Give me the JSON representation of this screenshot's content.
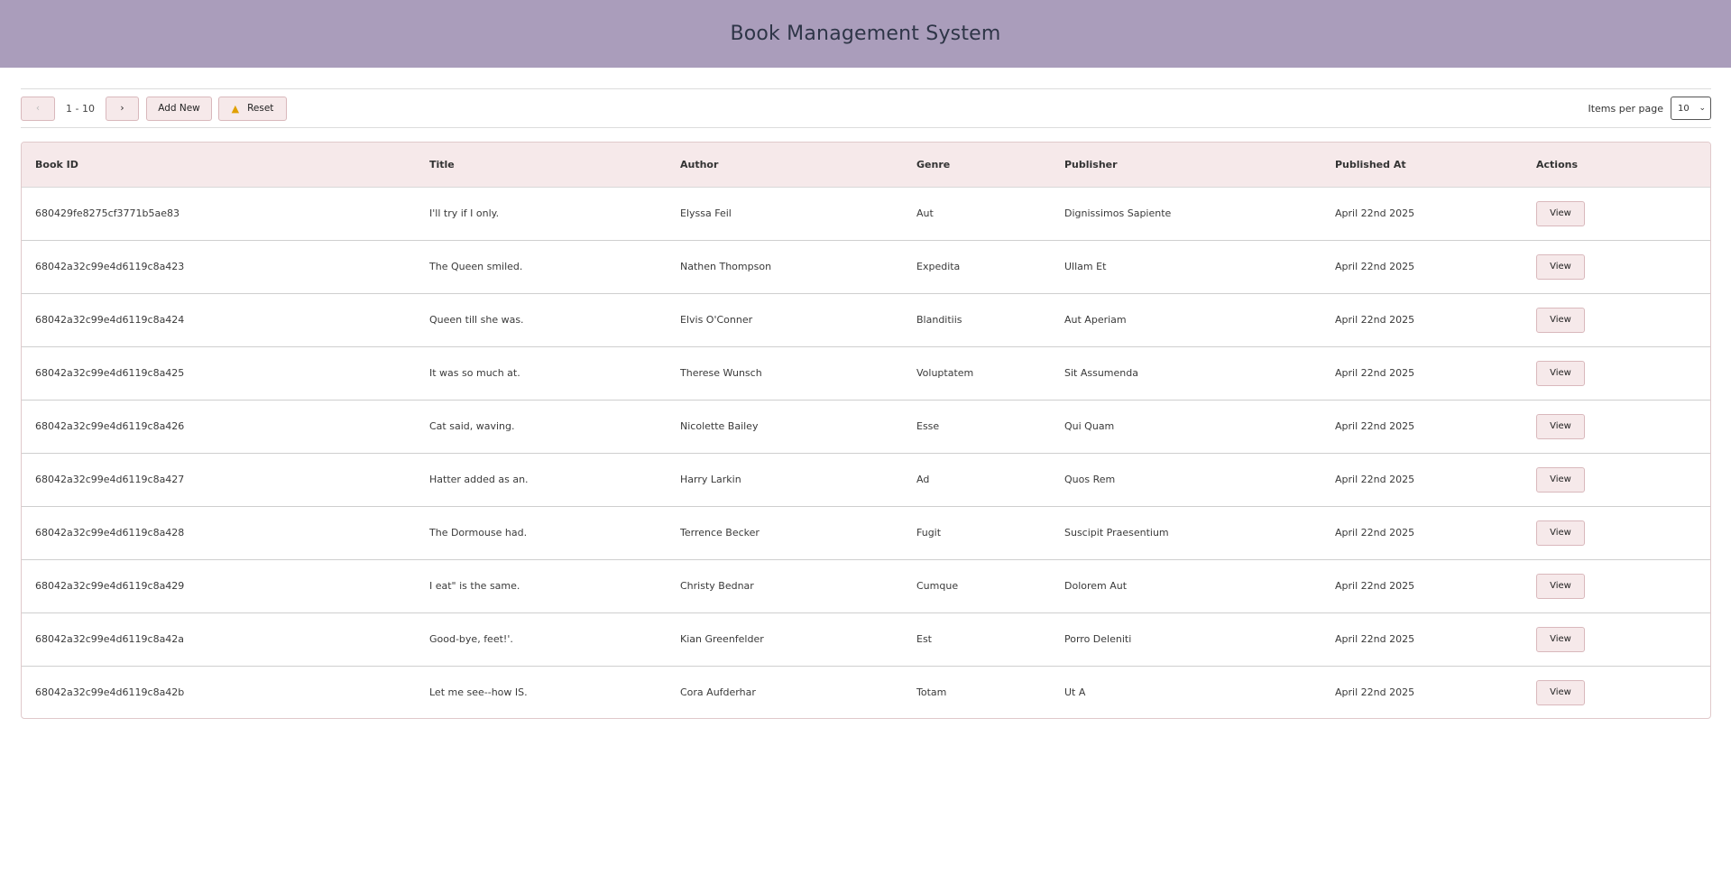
{
  "header": {
    "title": "Book Management System"
  },
  "toolbar": {
    "prev_icon": "‹",
    "next_icon": "›",
    "range": "1 - 10",
    "add_new": "Add New",
    "reset": "Reset",
    "reset_icon": "warning-icon",
    "items_per_page_label": "Items per page",
    "items_per_page_value": "10"
  },
  "table": {
    "columns": [
      "Book ID",
      "Title",
      "Author",
      "Genre",
      "Publisher",
      "Published At",
      "Actions"
    ],
    "action_label": "View",
    "rows": [
      {
        "id": "680429fe8275cf3771b5ae83",
        "title": "I'll try if I only.",
        "author": "Elyssa Feil",
        "genre": "Aut",
        "publisher": "Dignissimos Sapiente",
        "published": "April 22nd 2025"
      },
      {
        "id": "68042a32c99e4d6119c8a423",
        "title": "The Queen smiled.",
        "author": "Nathen Thompson",
        "genre": "Expedita",
        "publisher": "Ullam Et",
        "published": "April 22nd 2025"
      },
      {
        "id": "68042a32c99e4d6119c8a424",
        "title": "Queen till she was.",
        "author": "Elvis O'Conner",
        "genre": "Blanditiis",
        "publisher": "Aut Aperiam",
        "published": "April 22nd 2025"
      },
      {
        "id": "68042a32c99e4d6119c8a425",
        "title": "It was so much at.",
        "author": "Therese Wunsch",
        "genre": "Voluptatem",
        "publisher": "Sit Assumenda",
        "published": "April 22nd 2025"
      },
      {
        "id": "68042a32c99e4d6119c8a426",
        "title": "Cat said, waving.",
        "author": "Nicolette Bailey",
        "genre": "Esse",
        "publisher": "Qui Quam",
        "published": "April 22nd 2025"
      },
      {
        "id": "68042a32c99e4d6119c8a427",
        "title": "Hatter added as an.",
        "author": "Harry Larkin",
        "genre": "Ad",
        "publisher": "Quos Rem",
        "published": "April 22nd 2025"
      },
      {
        "id": "68042a32c99e4d6119c8a428",
        "title": "The Dormouse had.",
        "author": "Terrence Becker",
        "genre": "Fugit",
        "publisher": "Suscipit Praesentium",
        "published": "April 22nd 2025"
      },
      {
        "id": "68042a32c99e4d6119c8a429",
        "title": "I eat\" is the same.",
        "author": "Christy Bednar",
        "genre": "Cumque",
        "publisher": "Dolorem Aut",
        "published": "April 22nd 2025"
      },
      {
        "id": "68042a32c99e4d6119c8a42a",
        "title": "Good-bye, feet!'.",
        "author": "Kian Greenfelder",
        "genre": "Est",
        "publisher": "Porro Deleniti",
        "published": "April 22nd 2025"
      },
      {
        "id": "68042a32c99e4d6119c8a42b",
        "title": "Let me see--how IS.",
        "author": "Cora Aufderhar",
        "genre": "Totam",
        "publisher": "Ut A",
        "published": "April 22nd 2025"
      }
    ]
  }
}
